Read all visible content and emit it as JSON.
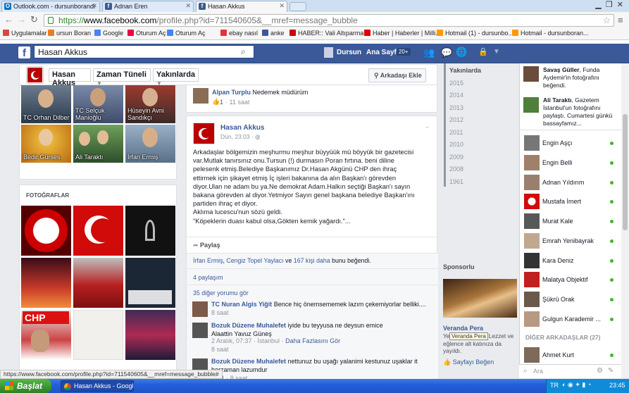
{
  "browser": {
    "tabs": [
      {
        "title": "Outlook.com - dursunborandi"
      },
      {
        "title": "Adnan Eren"
      },
      {
        "title": "Hasan Akkus",
        "active": true
      }
    ],
    "url_prefix": "https://",
    "url_host": "www.facebook.com",
    "url_path": "/profile.php?id=711540605&__mref=message_bubble",
    "bookmarks": [
      "Uygulamalar",
      "ursun Boran",
      "Google",
      "Oturum Aç",
      "Oturum Aç",
      "ebay nasıl",
      "anke",
      "HABER:: Vali Altıparma...",
      "Haber | Haberler | Milli...",
      "Hotmail (1) - dursunbo...",
      "Hotmail - dursunboran..."
    ],
    "status_url": "https://www.facebook.com/profile.php?id=711540605&__mref=message_bubble#"
  },
  "fb_header": {
    "search_value": "Hasan Akkus",
    "user_name": "Dursun",
    "home_label": "Ana Sayfa",
    "home_count": "20+"
  },
  "profile_nav": {
    "name": "Hasan Akkus",
    "timeline": "Zaman Tüneli",
    "friends": "Yakınlarda",
    "add_friend": "Arkadaşı Ekle"
  },
  "friends_grid": [
    {
      "name": "TC Orhan Dilber"
    },
    {
      "name": "TC Selçuk Manioğlu"
    },
    {
      "name": "Hüseyin Avni Sandıkçı"
    },
    {
      "name": "Bedir Gürses"
    },
    {
      "name": "Ali Taraktı"
    },
    {
      "name": "İrfan Ermiş"
    }
  ],
  "photos_title": "FOTOĞRAFLAR",
  "top_comment": {
    "author": "Alpan Turplu",
    "text": "Nedemek müdürüm",
    "likes": "1",
    "time": "11 saat"
  },
  "post": {
    "author": "Hasan Akkus",
    "time": "Dün, 23:03",
    "body_lines": [
      "Arkadaşlar bölgemizin meşhurmu meşhur büyyüük mü böyyük bir gazetecisi",
      "var.Mutlak tanırsınız onu.Tursun (!) durmasın Poran fırtına. beni diline",
      "pelesenk etmiş.Belediye Başkanımız Dr.Hasan Akgünü CHP den ihraç",
      "ettirmek için şikayet etmiş İç işleri bakanına da alın Başkan'ı görevden",
      "diyor.Ulan ne adam bu ya.Ne demokrat Adam.Halkın seçtiği Başkan'ı sayın",
      "bakana görevden al diyor.Yetmiyor Sayın genel başkana belediye Başkan'ını",
      "partiden ihraç et diyor.",
      "Aklıma lucescu'nun sözü geldi.",
      "\"Köpeklerin duası kabul olsa,Gökten kemik yağardı.\"..."
    ],
    "share_label": "Paylaş",
    "likes_a": "İrfan Ermiş",
    "likes_sep1": ", ",
    "likes_b": "Cengiz Topel Yaylacı",
    "likes_sep2": " ve ",
    "likes_c": "167 kişi daha",
    "likes_suffix": " bunu beğendi.",
    "shares": "4 paylaşım",
    "more_comments": "35 diğer yorumu gör"
  },
  "comments": [
    {
      "author": "TC Nuran Algis Yiğit",
      "text": "Bence hiç önemsememek lazım çekemiyorlar belliki....",
      "meta": "8 saat"
    },
    {
      "author": "Bozuk Düzene Muhalefet",
      "text": "iyide bu teyyusa ne deysun emice",
      "text2": "Alaattin Yavuz Güneş",
      "meta2a": "2 Aralık, 07:37 · İstanbul ·",
      "meta2b": "Daha Fazlasını Gör",
      "meta": "8 saat"
    },
    {
      "author": "Bozuk Düzene Muhalefet",
      "text": "nettunuz bu uşağı yalanimi kestunuz uşaklar it",
      "text2": "herzaman lazumdur",
      "likes": "1",
      "meta": "8 saat"
    }
  ],
  "years": {
    "header": "Yakınlarda",
    "items": [
      "2015",
      "2014",
      "2013",
      "2012",
      "2011",
      "2010",
      "2009",
      "2008",
      "1961"
    ]
  },
  "sponsor": {
    "title": "Sponsorlu",
    "ad_title": "Veranda Pera",
    "ad_text": "Yeni salon açıldı! Lezzet ve eğlence alt katınıza da yayıldı.",
    "tooltip": "Veranda Pera",
    "like_label": "Sayfayı Beğen"
  },
  "ticker": [
    {
      "author": "Savaş Güller",
      "text": ", Funda Aydemir'in fotoğrafını beğendi."
    },
    {
      "author": "Ali Taraktı",
      "text": ", Gazetem İstanbul'un fotoğrafını paylaştı. Cumartesi günkü bassayfamız..."
    }
  ],
  "chat_friends": [
    "Engin Aşçı",
    "Engin Belli",
    "Adnan Yıldırım",
    "Mustafa İmert",
    "Murat Kale",
    "Emrah Yenibayrak",
    "Kara Deniz",
    "Malatya Objektif",
    "Şükrü Orak",
    "Gulgun Karademir ..."
  ],
  "other_friends_title": "DİĞER ARKADAŞLAR (27)",
  "other_friends": [
    "Ahmet Kurt"
  ],
  "chat_search_placeholder": "Ara",
  "taskbar": {
    "start": "Başlat",
    "window": "Hasan Akkus - Google...",
    "lang": "TR",
    "clock": "23:45"
  },
  "colors": {
    "fb_blue": "#3b5998",
    "link": "#3b5998",
    "online": "#42b72a",
    "taskbar": "#245edb",
    "start": "#3c9a33"
  }
}
